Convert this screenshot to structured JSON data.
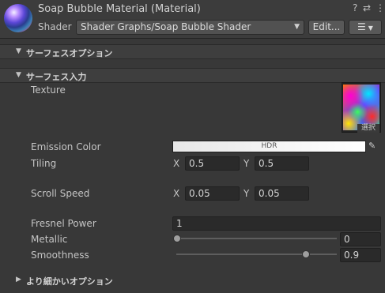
{
  "header": {
    "title": "Soap Bubble Material (Material)",
    "help_icon": "?",
    "settings_icon": "⇄",
    "more_icon": "⋮",
    "shader_label": "Shader",
    "shader_value": "Shader Graphs/Soap Bubble Shader",
    "edit_label": "Edit...",
    "list_icon": "☰"
  },
  "sections": {
    "surface_options": "サーフェスオプション",
    "surface_inputs": "サーフェス入力",
    "advanced_options": "より細かいオプション"
  },
  "properties": {
    "texture_label": "Texture",
    "texture_select": "選択",
    "emission_label": "Emission Color",
    "emission_hdr": "HDR",
    "tiling_label": "Tiling",
    "tiling_x_axis": "X",
    "tiling_x": "0.5",
    "tiling_y_axis": "Y",
    "tiling_y": "0.5",
    "scroll_label": "Scroll Speed",
    "scroll_x_axis": "X",
    "scroll_x": "0.05",
    "scroll_y_axis": "Y",
    "scroll_y": "0.05",
    "fresnel_label": "Fresnel Power",
    "fresnel_value": "1",
    "metallic_label": "Metallic",
    "metallic_value": "0",
    "metallic_level": 0,
    "smoothness_label": "Smoothness",
    "smoothness_value": "0.9",
    "smoothness_level": 0.9
  },
  "colors": {
    "background": "#383838",
    "field_bg": "#2a2a2a",
    "text": "#c4c4c4"
  }
}
